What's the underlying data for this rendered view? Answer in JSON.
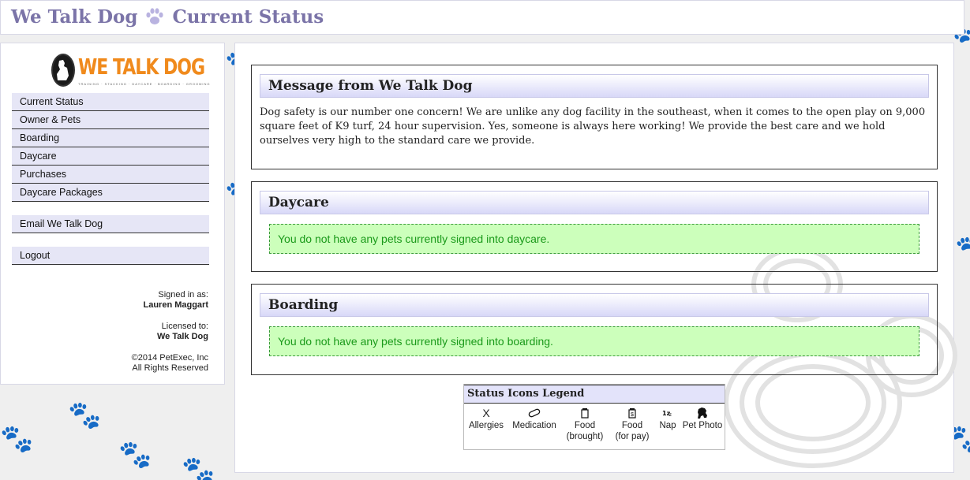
{
  "header": {
    "app_name": "We Talk Dog",
    "page_name": "Current Status"
  },
  "logo": {
    "text": "WE TALK DOG",
    "tagline": "TRAINING · STACKING · DAYCARE · BOARDING · GROOMING"
  },
  "sidebar": {
    "nav": [
      "Current Status",
      "Owner & Pets",
      "Boarding",
      "Daycare",
      "Purchases",
      "Daycare Packages"
    ],
    "email": "Email We Talk Dog",
    "logout": "Logout",
    "signed_in_label": "Signed in as:",
    "signed_in_user": "Lauren Maggart",
    "licensed_label": "Licensed to:",
    "licensed_to": "We Talk Dog",
    "copyright": "©2014 PetExec, Inc",
    "rights": "All Rights Reserved"
  },
  "message": {
    "title": "Message from We Talk Dog",
    "body": "Dog safety is our number one concern!  We are unlike any dog facility in the southeast, when it comes to the open play on 9,000 square feet of K9 turf, 24 hour supervision. Yes, someone is always here working! We provide the best care and we hold ourselves very high to the standard care we provide."
  },
  "daycare": {
    "title": "Daycare",
    "notice": "You do not have any pets currently signed into daycare."
  },
  "boarding": {
    "title": "Boarding",
    "notice": "You do not have any pets currently signed into boarding."
  },
  "legend": {
    "title": "Status Icons Legend",
    "items": [
      {
        "glyph": "X",
        "label": "Allergies",
        "label2": ""
      },
      {
        "glyph": "pill-icon",
        "label": "Medication",
        "label2": ""
      },
      {
        "glyph": "food-brought-icon",
        "label": "Food",
        "label2": "(brought)"
      },
      {
        "glyph": "food-pay-icon",
        "label": "Food",
        "label2": "(for pay)"
      },
      {
        "glyph": "nap-icon",
        "label": "Nap",
        "label2": ""
      },
      {
        "glyph": "dog-photo-icon",
        "label": "Pet Photo",
        "label2": ""
      }
    ]
  },
  "colors": {
    "accent": "#7b74a8",
    "nav_bg": "#e6e6f6",
    "notice_bg": "#ccffbb",
    "notice_text": "#1a9a1a",
    "logo": "#f08a1c"
  }
}
